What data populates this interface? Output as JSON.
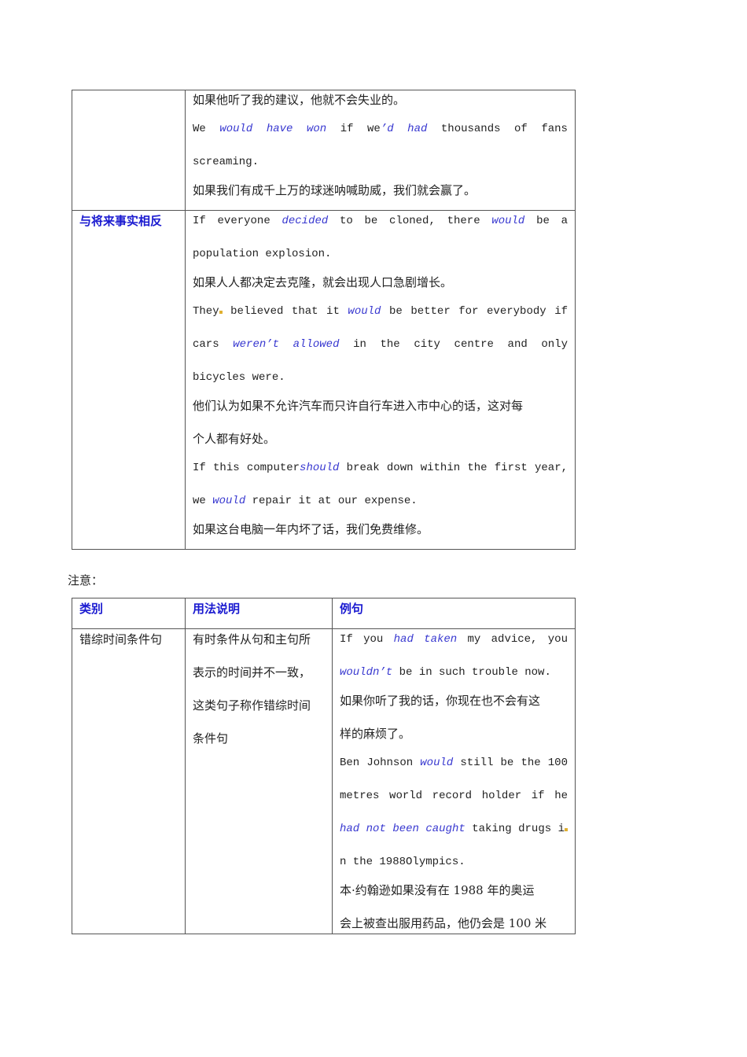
{
  "table1": {
    "row1_category": "",
    "row1_examples": [
      {
        "parts": [
          {
            "t": "如果他听了我的建议，他就不会失业的。",
            "cn": true
          }
        ]
      },
      {
        "j": true,
        "parts": [
          {
            "t": "We "
          },
          {
            "t": "would have won",
            "em": true
          },
          {
            "t": " if we"
          },
          {
            "t": "’d had",
            "em": true
          },
          {
            "t": " thousands of fans"
          }
        ]
      },
      {
        "parts": [
          {
            "t": "screaming."
          }
        ]
      },
      {
        "parts": [
          {
            "t": "如果我们有成千上万的球迷呐喊助威，我们就会赢了。",
            "cn": true
          }
        ]
      }
    ],
    "row2_category": "与将来事实相反",
    "row2_examples": [
      {
        "j": true,
        "parts": [
          {
            "t": "If everyone "
          },
          {
            "t": "decided",
            "em": true
          },
          {
            "t": " to be cloned, there "
          },
          {
            "t": "would",
            "em": true
          },
          {
            "t": " be a"
          }
        ]
      },
      {
        "parts": [
          {
            "t": "population explosion."
          }
        ]
      },
      {
        "parts": [
          {
            "t": "如果人人都决定去克隆，就会出现人口急剧增长。",
            "cn": true
          }
        ]
      },
      {
        "j": true,
        "mark_after_first": true,
        "parts": [
          {
            "t": "They"
          },
          {
            "t": " believed that it "
          },
          {
            "t": "would",
            "em": true
          },
          {
            "t": " be better for everybody if"
          }
        ]
      },
      {
        "j": true,
        "parts": [
          {
            "t": "cars "
          },
          {
            "t": "weren’t allowed",
            "em": true
          },
          {
            "t": " in the city centre and only"
          }
        ]
      },
      {
        "parts": [
          {
            "t": "bicycles were."
          }
        ]
      },
      {
        "parts": [
          {
            "t": "他们认为如果不允许汽车而只许自行车进入市中心的话，这对每",
            "cn": true
          }
        ]
      },
      {
        "parts": [
          {
            "t": "个人都有好处。",
            "cn": true
          }
        ]
      },
      {
        "j": true,
        "parts": [
          {
            "t": "If this computer"
          },
          {
            "t": "should",
            "em": true
          },
          {
            "t": " break down within the first year,"
          }
        ]
      },
      {
        "parts": [
          {
            "t": "we "
          },
          {
            "t": "would",
            "em": true
          },
          {
            "t": " repair it at our expense."
          }
        ]
      },
      {
        "parts": [
          {
            "t": "如果这台电脑一年内坏了话，我们免费维修。",
            "cn": true
          }
        ]
      }
    ]
  },
  "note_label": "注意：",
  "table2": {
    "headers": [
      "类别",
      "用法说明",
      "例句"
    ],
    "category_lines": [
      {
        "parts": [
          {
            "t": "错综时间条件句",
            "cn": true
          }
        ]
      }
    ],
    "usage_lines": [
      {
        "parts": [
          {
            "t": "有时条件从句和主句所",
            "cn": true
          }
        ]
      },
      {
        "parts": [
          {
            "t": "表示的时间并不一致，",
            "cn": true
          }
        ]
      },
      {
        "parts": [
          {
            "t": "这类句子称作错综时间",
            "cn": true
          }
        ]
      },
      {
        "parts": [
          {
            "t": "条件句",
            "cn": true
          }
        ]
      }
    ],
    "example_lines": [
      {
        "j": true,
        "parts": [
          {
            "t": "If you "
          },
          {
            "t": "had taken",
            "em": true
          },
          {
            "t": " my advice, you"
          }
        ]
      },
      {
        "parts": [
          {
            "t": "wouldn’t",
            "em": true
          },
          {
            "t": " be in such trouble now."
          }
        ]
      },
      {
        "parts": [
          {
            "t": "如果你听了我的话，你现在也不会有这",
            "cn": true
          }
        ]
      },
      {
        "parts": [
          {
            "t": "样的麻烦了。",
            "cn": true
          }
        ]
      },
      {
        "j": true,
        "parts": [
          {
            "t": "Ben Johnson "
          },
          {
            "t": "would",
            "em": true
          },
          {
            "t": " still be the 100"
          }
        ]
      },
      {
        "j": true,
        "parts": [
          {
            "t": "metres world record holder if he"
          }
        ]
      },
      {
        "j": true,
        "mark_at_end": true,
        "parts": [
          {
            "t": "had not been caught",
            "em": true
          },
          {
            "t": " taking drugs i"
          }
        ]
      },
      {
        "parts": [
          {
            "t": "n the 1988Olympics."
          }
        ]
      },
      {
        "parts": [
          {
            "t": "本·约翰逊如果没有在 1988 年的奥运",
            "cn": true
          }
        ]
      },
      {
        "parts": [
          {
            "t": "会上被查出服用药品，他仍会是 100 米",
            "cn": true
          }
        ]
      }
    ]
  }
}
